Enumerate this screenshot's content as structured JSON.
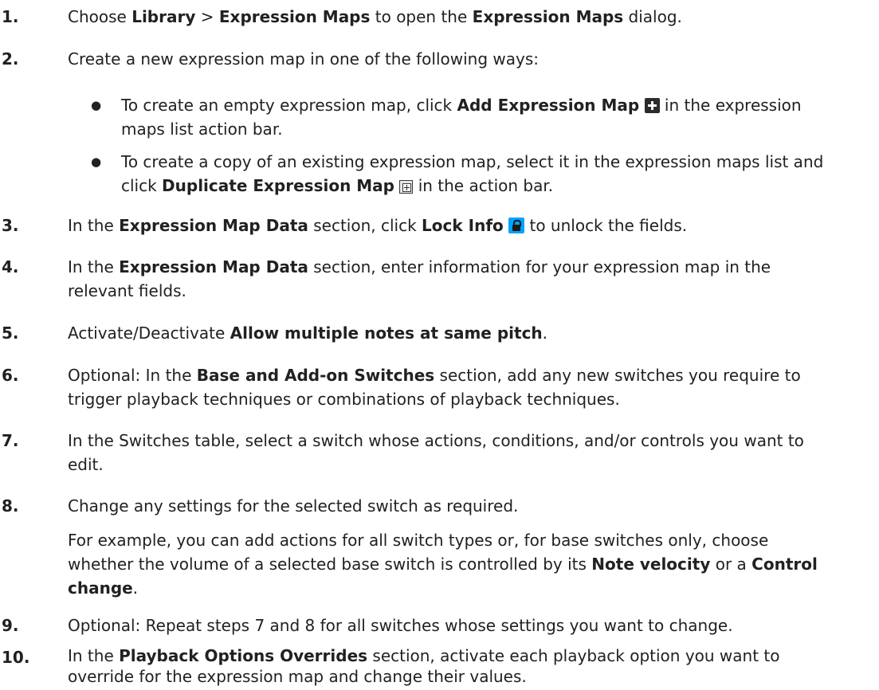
{
  "steps": [
    {
      "num": "1.",
      "parts": [
        "Choose ",
        "Library",
        " > ",
        "Expression Maps",
        " to open the ",
        "Expression Maps",
        " dialog."
      ]
    },
    {
      "num": "2.",
      "text": "Create a new expression map in one of the following ways:",
      "bullets": [
        {
          "dot": "●",
          "parts": [
            "To create an empty expression map, click ",
            "Add Expression Map",
            " in the expression",
            "maps list action bar."
          ],
          "icon": "add-expression-map-icon"
        },
        {
          "dot": "●",
          "parts": [
            "To create a copy of an existing expression map, select it in the expression maps list and",
            "click ",
            "Duplicate Expression Map",
            " in the action bar."
          ],
          "icon": "duplicate-expression-map-icon"
        }
      ]
    },
    {
      "num": "3.",
      "parts": [
        "In the ",
        "Expression Map Data",
        " section, click ",
        "Lock Info",
        " to unlock the fields."
      ],
      "icon": "lock-icon"
    },
    {
      "num": "4.",
      "parts": [
        "In the ",
        "Expression Map Data",
        " section, enter information for your expression map in the",
        "relevant fields."
      ]
    },
    {
      "num": "5.",
      "parts": [
        "Activate/Deactivate ",
        "Allow multiple notes at same pitch",
        "."
      ]
    },
    {
      "num": "6.",
      "parts": [
        "Optional: In the ",
        "Base and Add-on Switches",
        " section, add any new switches you require to",
        "trigger playback techniques or combinations of playback techniques."
      ]
    },
    {
      "num": "7.",
      "parts": [
        "In the Switches table, select a switch whose actions, conditions, and/or controls you want to",
        "edit."
      ]
    },
    {
      "num": "8.",
      "text": "Change any settings for the selected switch as required.",
      "example": [
        "For example, you can add actions for all switch types or, for base switches only, choose",
        "whether the volume of a selected base switch is controlled by its ",
        "Note velocity",
        " or a ",
        "Control",
        "change",
        "."
      ]
    },
    {
      "num": "9.",
      "text": "Optional: Repeat steps 7 and 8 for all switches whose settings you want to change."
    },
    {
      "num": "10.",
      "parts": [
        "In the ",
        "Playback Options Overrides",
        " section, activate each playback option you want to",
        "override for the expression map and change their values."
      ]
    }
  ]
}
